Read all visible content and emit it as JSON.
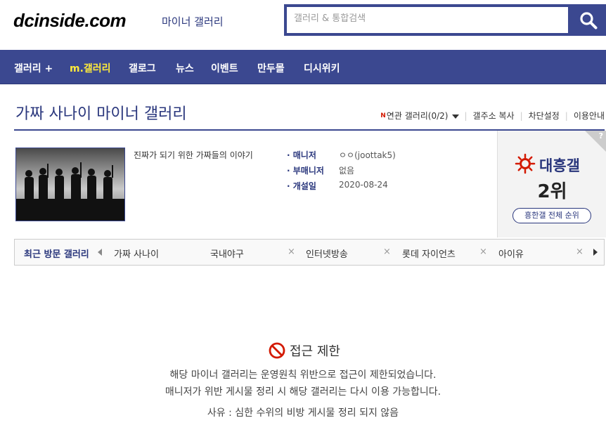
{
  "header": {
    "logo": "dcinside.com",
    "logo_sub": "마이너 갤러리",
    "search_placeholder": "갤러리 & 통합검색"
  },
  "nav": [
    {
      "label": "갤러리 +",
      "highlight": false
    },
    {
      "label": "m.갤러리",
      "highlight": true
    },
    {
      "label": "갤로그",
      "highlight": false
    },
    {
      "label": "뉴스",
      "highlight": false
    },
    {
      "label": "이벤트",
      "highlight": false
    },
    {
      "label": "만두몰",
      "highlight": false
    },
    {
      "label": "디시위키",
      "highlight": false
    }
  ],
  "gallery": {
    "title": "가짜 사나이 마이너 갤러리",
    "links": {
      "new_badge": "N",
      "related": "연관 갤러리(0/2)",
      "copy_address": "갤주소 복사",
      "block_settings": "차단설정",
      "guide": "이용안내"
    },
    "description": "진짜가 되기 위한 가짜들의 이야기",
    "info": [
      {
        "label": "매니저",
        "value": "ㅇㅇ(joottak5)"
      },
      {
        "label": "부매니저",
        "value": "없음"
      },
      {
        "label": "개설일",
        "value": "2020-08-24"
      }
    ]
  },
  "rank": {
    "help": "?",
    "name": "대흥갤",
    "value": "2위",
    "button": "흥한갤 전체 순위"
  },
  "recent": {
    "title": "최근 방문 갤러리",
    "items": [
      "가짜 사나이",
      "국내야구",
      "인터넷방송",
      "롯데 자이언츠",
      "아이유"
    ],
    "close_symbol": "×"
  },
  "notice": {
    "title": "접근 제한",
    "line1": "해당 마이너 갤러리는 운영원칙 위반으로 접근이 제한되었습니다.",
    "line2": "매니저가 위반 게시물 정리 시 해당 갤러리는 다시 이용 가능합니다.",
    "reason": "사유 : 심한 수위의 비방 게시물 정리 되지 않음"
  },
  "colors": {
    "brand": "#3b4890",
    "nav_highlight": "#ffeb3b",
    "rank_accent": "#d31900"
  }
}
